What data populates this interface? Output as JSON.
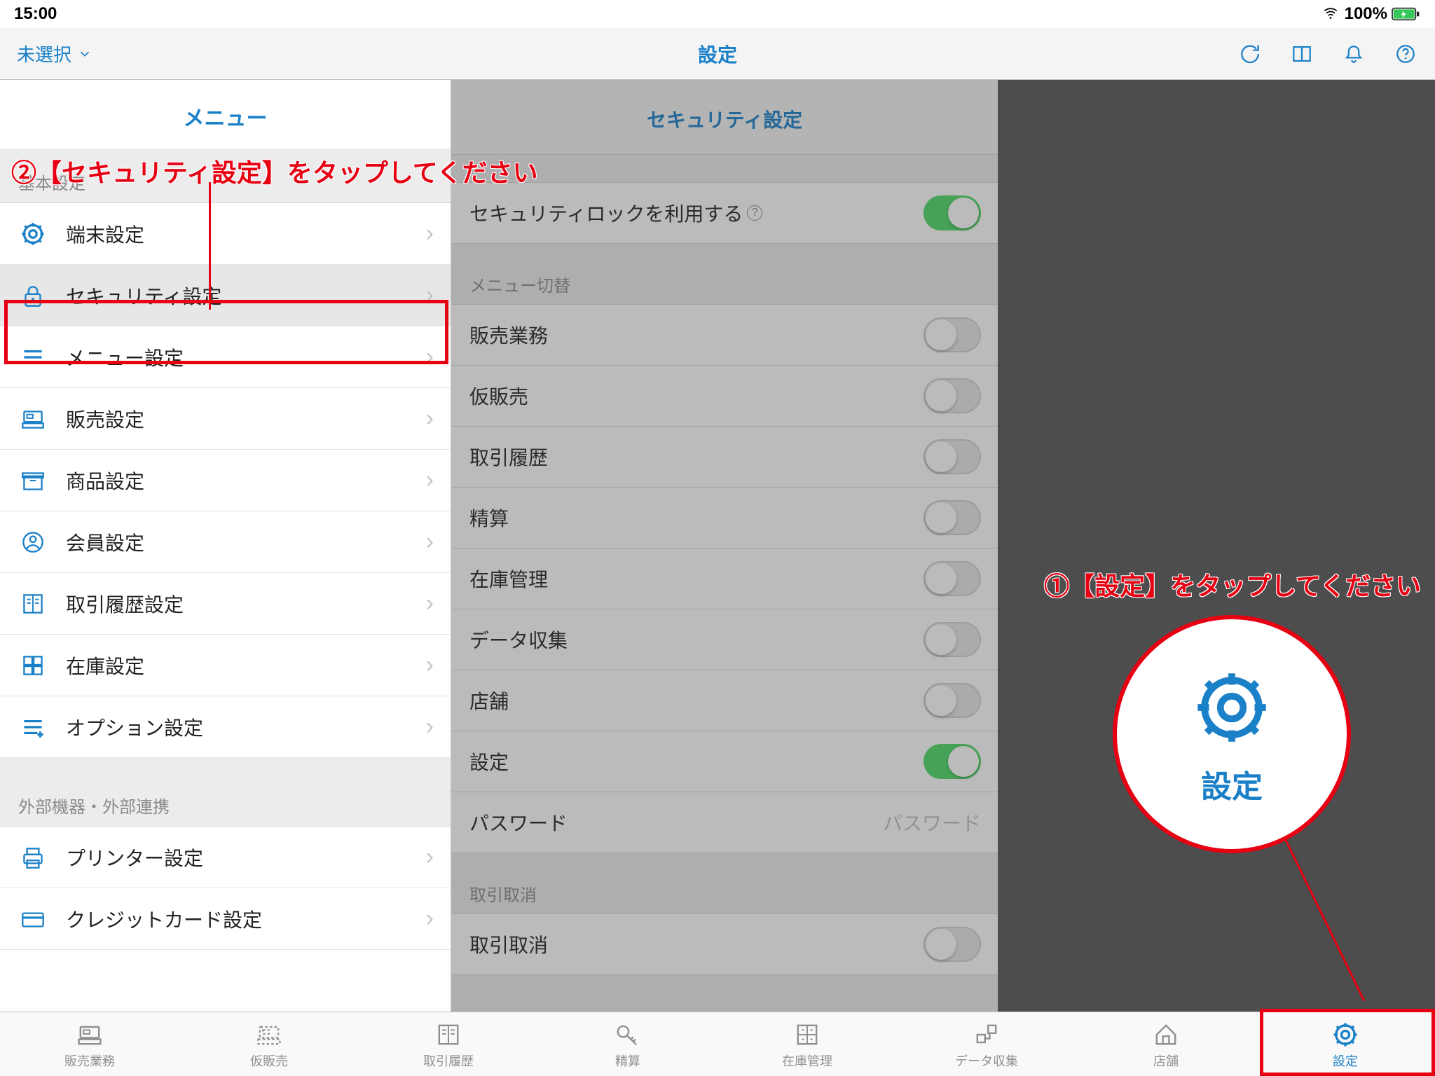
{
  "status": {
    "time": "15:00",
    "battery": "100%"
  },
  "header": {
    "left_label": "未選択",
    "title": "設定"
  },
  "sidebar": {
    "title": "メニュー",
    "sections": [
      {
        "head": "基本設定",
        "items": [
          {
            "icon": "gear",
            "label": "端末設定"
          },
          {
            "icon": "lock",
            "label": "セキュリティ設定",
            "selected": true
          },
          {
            "icon": "menu",
            "label": "メニュー設定"
          },
          {
            "icon": "register",
            "label": "販売設定"
          },
          {
            "icon": "box",
            "label": "商品設定"
          },
          {
            "icon": "user",
            "label": "会員設定"
          },
          {
            "icon": "book",
            "label": "取引履歴設定"
          },
          {
            "icon": "grid",
            "label": "在庫設定"
          },
          {
            "icon": "lines",
            "label": "オプション設定"
          }
        ]
      },
      {
        "head": "外部機器・外部連携",
        "items": [
          {
            "icon": "printer",
            "label": "プリンター設定"
          },
          {
            "icon": "card",
            "label": "クレジットカード設定"
          }
        ]
      }
    ]
  },
  "detail": {
    "title": "セキュリティ設定",
    "row_main": {
      "label": "セキュリティロックを利用する",
      "on": true
    },
    "sec1_head": "メニュー切替",
    "sec1_rows": [
      {
        "label": "販売業務",
        "on": false
      },
      {
        "label": "仮販売",
        "on": false
      },
      {
        "label": "取引履歴",
        "on": false
      },
      {
        "label": "精算",
        "on": false
      },
      {
        "label": "在庫管理",
        "on": false
      },
      {
        "label": "データ収集",
        "on": false
      },
      {
        "label": "店舗",
        "on": false
      },
      {
        "label": "設定",
        "on": true
      }
    ],
    "password_label": "パスワード",
    "password_placeholder": "パスワード",
    "sec2_head": "取引取消",
    "sec2_rows": [
      {
        "label": "取引取消",
        "on": false
      }
    ]
  },
  "tabs": [
    {
      "label": "販売業務"
    },
    {
      "label": "仮販売"
    },
    {
      "label": "取引履歴"
    },
    {
      "label": "精算"
    },
    {
      "label": "在庫管理"
    },
    {
      "label": "データ収集"
    },
    {
      "label": "店舗"
    },
    {
      "label": "設定",
      "active": true
    }
  ],
  "annotations": {
    "a1": "②【セキュリティ設定】をタップしてください",
    "a2": "①【設定】をタップしてください",
    "bubble_label": "設定"
  }
}
